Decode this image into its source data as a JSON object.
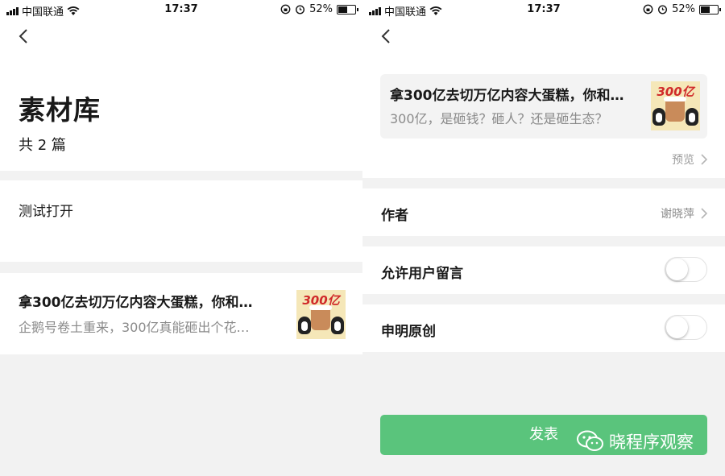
{
  "status": {
    "carrier": "中国联通",
    "time": "17:37",
    "battery": "52%",
    "battery_level": 0.52
  },
  "left": {
    "title": "素材库",
    "count": "共 2 篇",
    "items": [
      {
        "label": "测试打开"
      },
      {
        "title": "拿300亿去切万亿内容大蛋糕，你和…",
        "desc": "企鹅号卷土重来，300亿真能砸出个花…",
        "thumb_text": "300亿"
      }
    ]
  },
  "right": {
    "article": {
      "title": "拿300亿去切万亿内容大蛋糕，你和…",
      "desc": "300亿，是砸钱？砸人？还是砸生态？",
      "thumb_text": "300亿"
    },
    "preview": "预览",
    "author_label": "作者",
    "author_value": "谢晓萍",
    "allow_comments": "允许用户留言",
    "original": "申明原创",
    "publish": "发表"
  },
  "watermark": "晓程序观察",
  "colors": {
    "accent": "#5ac47c",
    "background": "#f2f2f2"
  },
  "toggles": {
    "allow_comments": false,
    "original": false
  }
}
